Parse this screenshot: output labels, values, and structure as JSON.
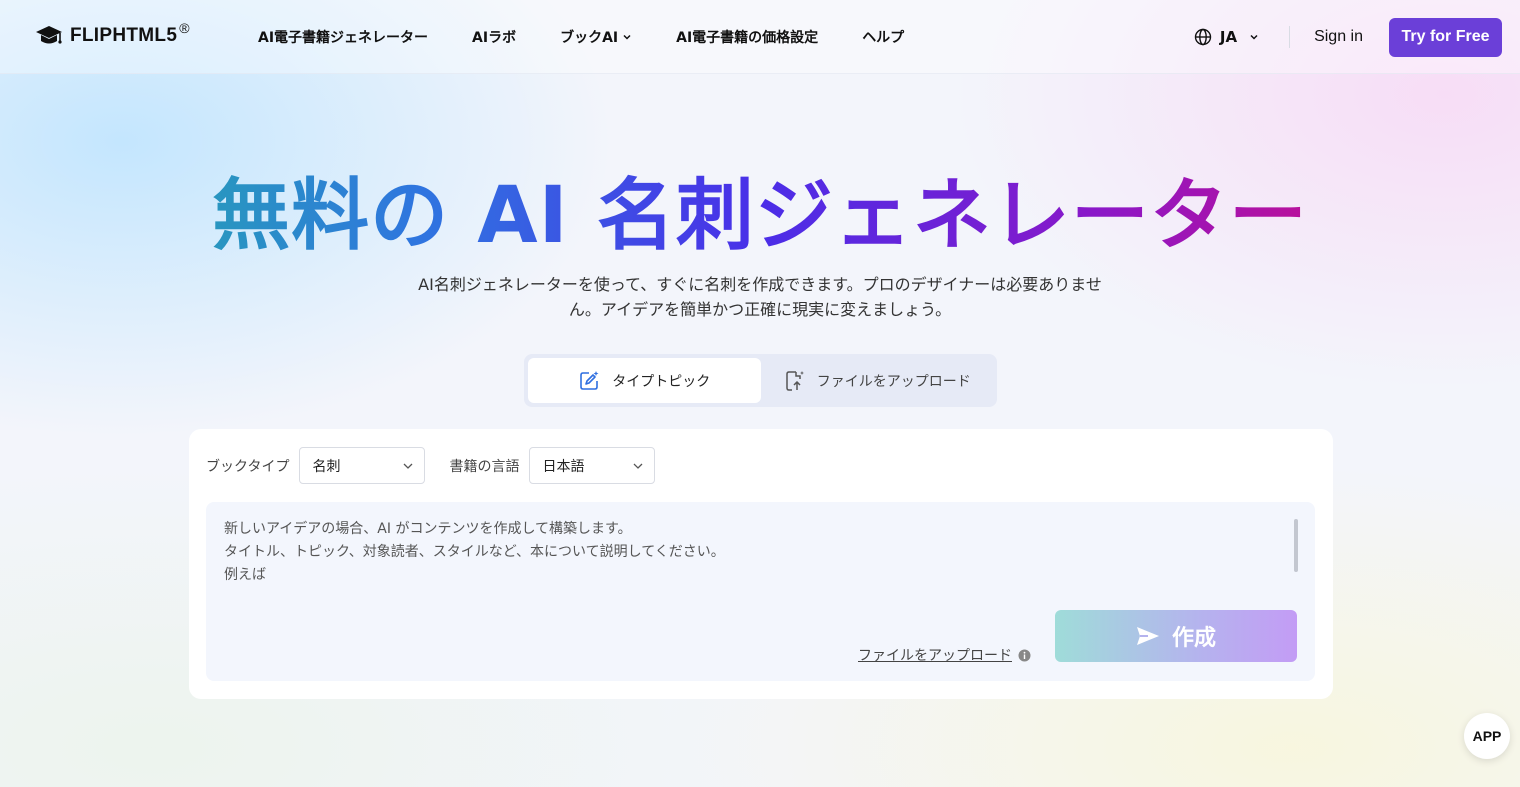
{
  "header": {
    "logo_text": "FLIPHTML5",
    "logo_mark": "®",
    "nav": [
      {
        "label": "AI電子書籍ジェネレーター"
      },
      {
        "label": "AIラボ"
      },
      {
        "label": "ブックAI"
      },
      {
        "label": "AI電子書籍の価格設定"
      },
      {
        "label": "ヘルプ"
      }
    ],
    "language": "JA",
    "sign_in": "Sign in",
    "try_free": "Try for Free"
  },
  "hero": {
    "title": "無料の AI 名刺ジェネレーター",
    "subtitle_line1": "AI名刺ジェネレーターを使って、すぐに名刺を作成できます。プロのデザイナーは必要ありませ",
    "subtitle_line2": "ん。アイデアを簡単かつ正確に現実に変えましょう。"
  },
  "tabs": [
    {
      "label": "タイプトピック",
      "icon": "edit-sparkle-icon",
      "active": true
    },
    {
      "label": "ファイルをアップロード",
      "icon": "file-upload-icon",
      "active": false
    }
  ],
  "form": {
    "book_type_label": "ブックタイプ",
    "book_type_value": "名刺",
    "language_label": "書籍の言語",
    "language_value": "日本語",
    "placeholder_lines": [
      "新しいアイデアの場合、AI がコンテンツを作成して構築します。",
      "タイトル、トピック、対象読者、スタイルなど、本について説明してください。",
      "例えば"
    ],
    "upload_link": "ファイルをアップロード",
    "create_button": "作成"
  },
  "app_badge": "APP",
  "colors": {
    "brand_purple": "#6b3fd8",
    "title_gradient": [
      "#22b8a0",
      "#2f74e0",
      "#4a2ee8",
      "#8a18c8",
      "#e8096f"
    ]
  }
}
